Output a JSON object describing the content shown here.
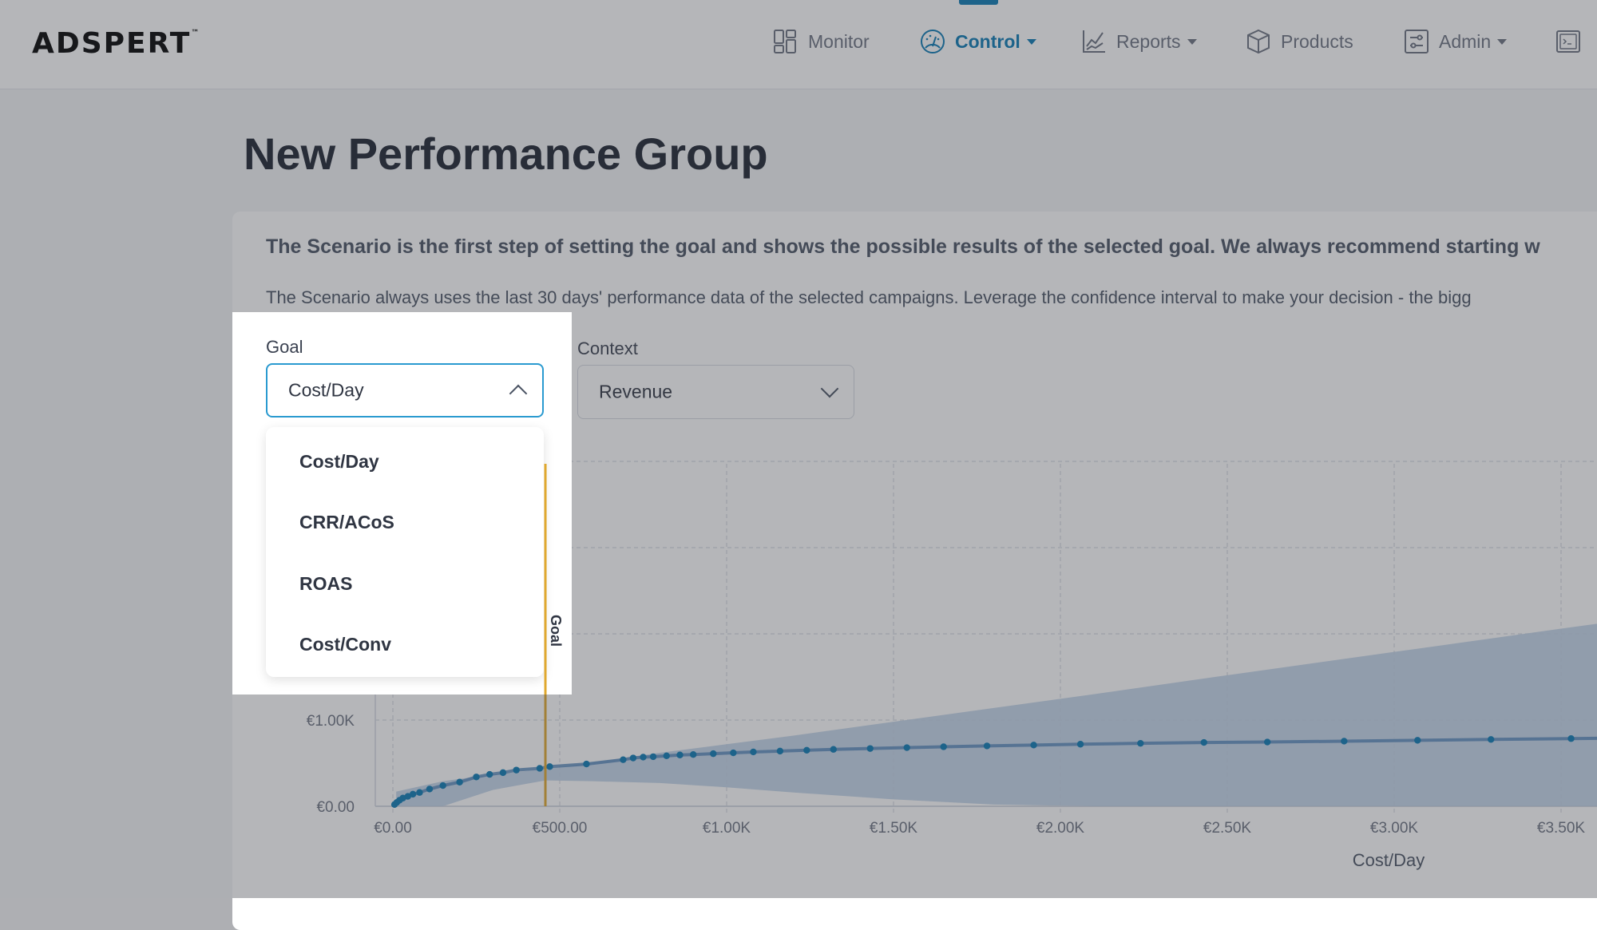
{
  "header": {
    "logo": "ADSPERT",
    "logo_tm": "™",
    "nav": [
      {
        "label": "Monitor",
        "icon": "dashboard-grid-icon",
        "dropdown": false,
        "active": false
      },
      {
        "label": "Control",
        "icon": "gauge-icon",
        "dropdown": true,
        "active": true
      },
      {
        "label": "Reports",
        "icon": "line-chart-icon",
        "dropdown": true,
        "active": false
      },
      {
        "label": "Products",
        "icon": "box-icon",
        "dropdown": false,
        "active": false
      },
      {
        "label": "Admin",
        "icon": "sliders-icon",
        "dropdown": true,
        "active": false
      },
      {
        "label": "",
        "icon": "terminal-icon",
        "dropdown": false,
        "active": false
      }
    ],
    "accent_color": "#0a79b3"
  },
  "page": {
    "title": "New Performance Group",
    "intro_bold": "The Scenario is the first step of setting the goal and shows the possible results of the selected goal. We always recommend starting w",
    "intro_regular": "The Scenario always uses the last 30 days' performance data of the selected campaigns. Leverage the confidence interval to make your decision - the bigg"
  },
  "form": {
    "goal": {
      "label": "Goal",
      "value": "Cost/Day",
      "open": true,
      "options": [
        "Cost/Day",
        "CRR/ACoS",
        "ROAS",
        "Cost/Conv"
      ]
    },
    "context": {
      "label": "Context",
      "value": "Revenue",
      "open": false
    }
  },
  "chart_data": {
    "type": "line",
    "title": "",
    "xlabel": "Cost/Day",
    "ylabel": "",
    "x_ticks": [
      "€0.00",
      "€500.00",
      "€1.00K",
      "€1.50K",
      "€2.00K",
      "€2.50K",
      "€3.00K",
      "€3.50K"
    ],
    "x_tick_values": [
      0,
      500,
      1000,
      1500,
      2000,
      2500,
      3000,
      3500
    ],
    "y_ticks_visible": [
      "€0.00",
      "€1.00K"
    ],
    "y_tick_values": [
      0,
      1000,
      2000,
      3000,
      4000
    ],
    "xlim": [
      0,
      3650
    ],
    "ylim": [
      0,
      4000
    ],
    "grid": true,
    "goal_marker": {
      "label": "Goal",
      "x": 457,
      "color": "#e0a82e"
    },
    "series": [
      {
        "name": "Revenue",
        "color": "#0a79b3",
        "x": [
          5,
          12,
          20,
          30,
          45,
          60,
          80,
          110,
          150,
          200,
          250,
          290,
          330,
          370,
          440,
          470,
          580,
          690,
          720,
          750,
          780,
          820,
          860,
          900,
          960,
          1020,
          1080,
          1160,
          1240,
          1320,
          1430,
          1540,
          1650,
          1780,
          1920,
          2060,
          2240,
          2430,
          2620,
          2850,
          3070,
          3290,
          3530,
          3650
        ],
        "y": [
          20,
          45,
          70,
          95,
          115,
          140,
          160,
          200,
          240,
          280,
          340,
          370,
          390,
          420,
          440,
          460,
          490,
          540,
          560,
          570,
          575,
          585,
          595,
          600,
          610,
          620,
          630,
          640,
          650,
          660,
          670,
          680,
          690,
          700,
          710,
          720,
          730,
          740,
          745,
          755,
          765,
          775,
          785,
          790
        ]
      }
    ],
    "confidence_band": {
      "x": [
        10,
        150,
        300,
        457,
        600,
        800,
        1000,
        1200,
        1500,
        1800,
        2100,
        2500,
        3000,
        3500,
        3650
      ],
      "upper": [
        170,
        290,
        370,
        430,
        510,
        620,
        720,
        820,
        980,
        1140,
        1300,
        1520,
        1790,
        2060,
        2140
      ],
      "lower": [
        0,
        0,
        190,
        300,
        290,
        270,
        220,
        160,
        80,
        20,
        0,
        0,
        0,
        0,
        0
      ]
    }
  }
}
